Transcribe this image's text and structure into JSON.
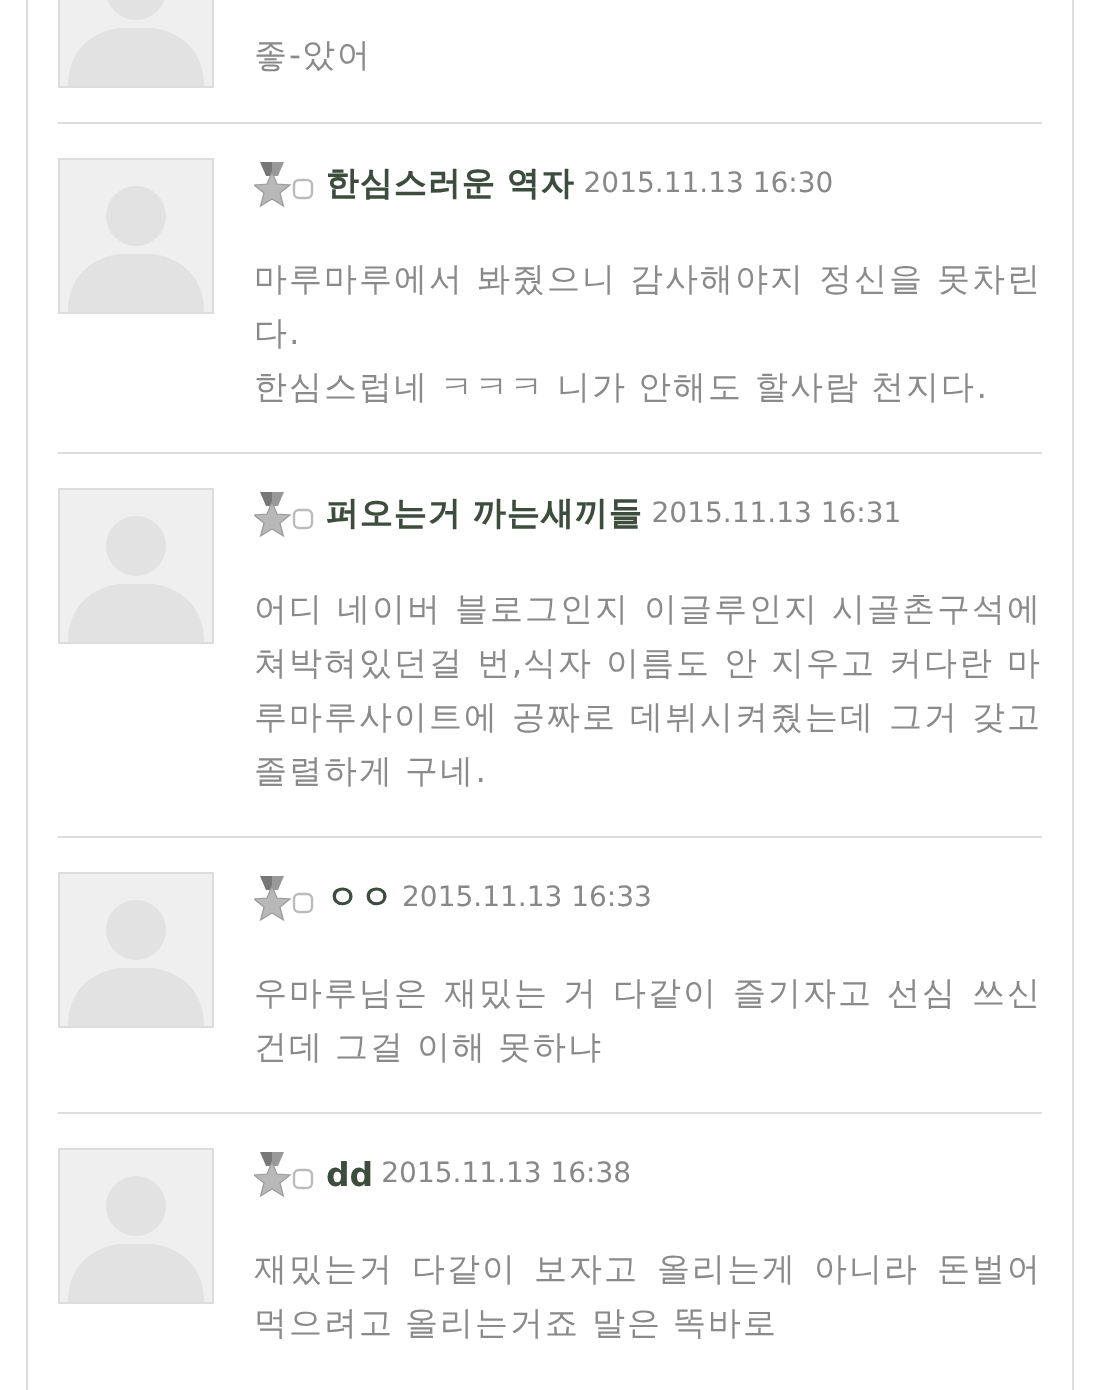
{
  "comments": [
    {
      "kind": "partial",
      "body": "좋-았어"
    },
    {
      "kind": "full",
      "name": "한심스러운 역자",
      "date": "2015.11.13 16:30",
      "body": "마루마루에서 봐줬으니 감사해야지 정신을 못차린다.\n한심스럽네 ㅋㅋㅋ 니가 안해도 할사람 천지다."
    },
    {
      "kind": "full",
      "name": "퍼오는거 까는새끼들",
      "date": "2015.11.13 16:31",
      "body": "어디 네이버 블로그인지 이글루인지 시골촌구석에 쳐박혀있던걸 번,식자 이름도 안 지우고 커다란 마루마루사이트에 공짜로 데뷔시켜줬는데 그거 갖고 졸렬하게 구네."
    },
    {
      "kind": "full",
      "name": "ㅇㅇ",
      "date": "2015.11.13 16:33",
      "body": "우마루님은 재밌는 거 다같이 즐기자고 선심 쓰신건데 그걸 이해 못하냐"
    },
    {
      "kind": "full",
      "name": "dd",
      "date": "2015.11.13 16:38",
      "body": "재밌는거 다같이 보자고 올리는게 아니라 돈벌어먹으려고 올리는거죠 말은 똑바로"
    }
  ]
}
